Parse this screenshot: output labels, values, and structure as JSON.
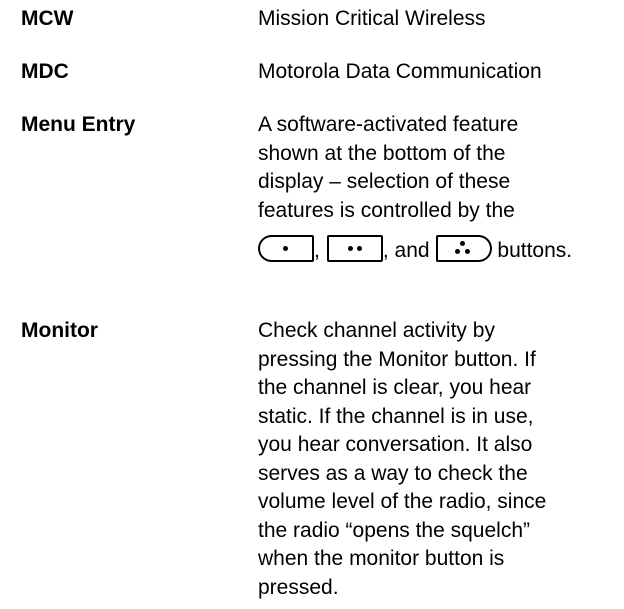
{
  "entries": [
    {
      "term": "MCW",
      "definition_lines": [
        "Mission Critical Wireless"
      ]
    },
    {
      "term": "MDC",
      "definition_lines": [
        "Motorola Data Communication"
      ]
    },
    {
      "term": "Menu Entry",
      "definition_lines": [
        "A software-activated feature",
        "shown at the bottom of the",
        "display – selection of these",
        "features is controlled by the"
      ],
      "button_line": {
        "sep1": ",",
        "sep2": ", and",
        "tail": " buttons."
      },
      "icons": [
        "left-softkey-icon",
        "center-softkey-icon",
        "right-softkey-icon"
      ]
    },
    {
      "term": "Monitor",
      "definition_lines": [
        "Check channel activity by",
        "pressing the Monitor button. If",
        "the channel is clear, you hear",
        "static. If the channel is in use,",
        "you hear conversation. It also",
        "serves as a way to check the",
        "volume level of the radio, since",
        "the radio “opens the squelch”",
        "when the monitor button is",
        "pressed."
      ]
    }
  ]
}
